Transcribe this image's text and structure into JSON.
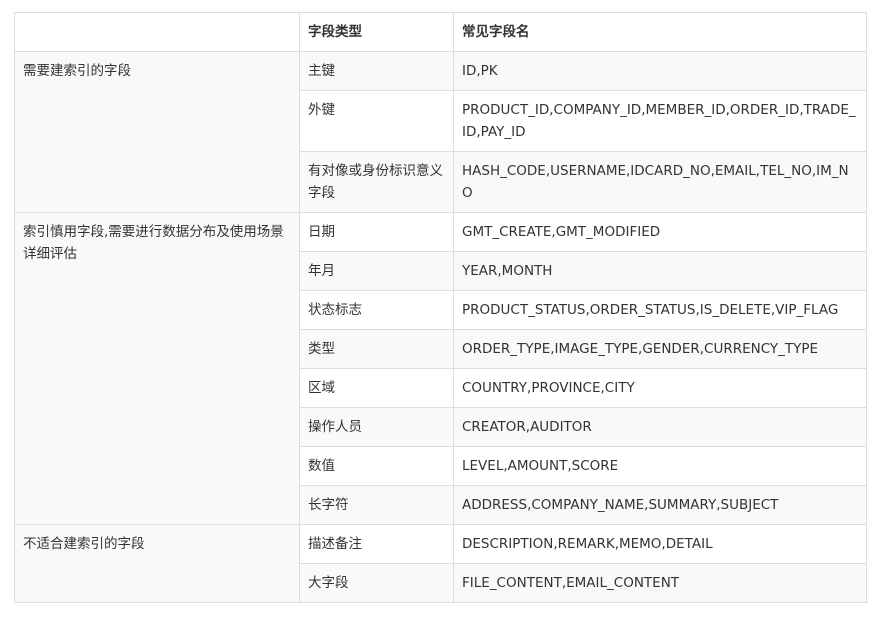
{
  "header": {
    "col1": "",
    "col2": "字段类型",
    "col3": "常见字段名"
  },
  "groups": [
    {
      "label": "需要建索引的字段",
      "rows": [
        {
          "type": "主键",
          "names": "ID,PK"
        },
        {
          "type": "外键",
          "names": "PRODUCT_ID,COMPANY_ID,MEMBER_ID,ORDER_ID,TRADE_ID,PAY_ID"
        },
        {
          "type": "有对像或身份标识意义字段",
          "names": "HASH_CODE,USERNAME,IDCARD_NO,EMAIL,TEL_NO,IM_NO"
        }
      ]
    },
    {
      "label": "索引慎用字段,需要进行数据分布及使用场景详细评估",
      "rows": [
        {
          "type": "日期",
          "names": "GMT_CREATE,GMT_MODIFIED"
        },
        {
          "type": "年月",
          "names": "YEAR,MONTH"
        },
        {
          "type": "状态标志",
          "names": "PRODUCT_STATUS,ORDER_STATUS,IS_DELETE,VIP_FLAG"
        },
        {
          "type": "类型",
          "names": "ORDER_TYPE,IMAGE_TYPE,GENDER,CURRENCY_TYPE"
        },
        {
          "type": "区域",
          "names": "COUNTRY,PROVINCE,CITY"
        },
        {
          "type": "操作人员",
          "names": "CREATOR,AUDITOR"
        },
        {
          "type": "数值",
          "names": "LEVEL,AMOUNT,SCORE"
        },
        {
          "type": "长字符",
          "names": "ADDRESS,COMPANY_NAME,SUMMARY,SUBJECT"
        }
      ]
    },
    {
      "label": "不适合建索引的字段",
      "rows": [
        {
          "type": "描述备注",
          "names": "DESCRIPTION,REMARK,MEMO,DETAIL"
        },
        {
          "type": "大字段",
          "names": "FILE_CONTENT,EMAIL_CONTENT"
        }
      ]
    }
  ]
}
